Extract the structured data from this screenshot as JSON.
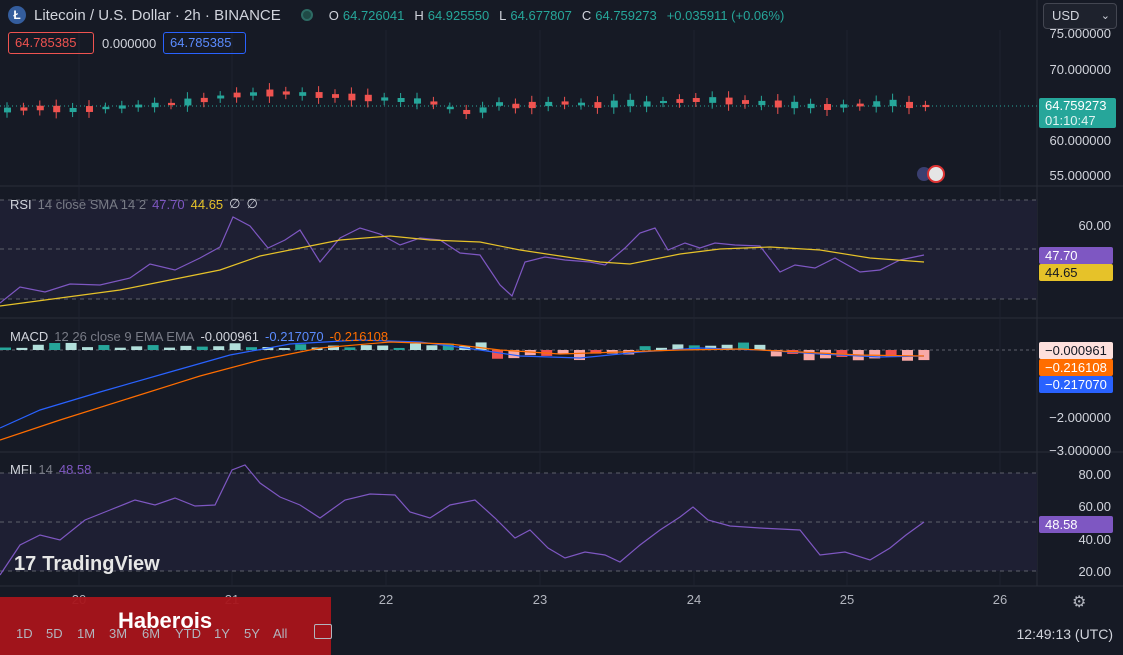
{
  "header": {
    "coin_symbol": "Ł",
    "title": "Litecoin / U.S. Dollar · 2h · BINANCE",
    "ohlc": {
      "o_label": "O",
      "o": "64.726041",
      "h_label": "H",
      "h": "64.925550",
      "l_label": "L",
      "l": "64.677807",
      "c_label": "C",
      "c": "64.759273",
      "change": "+0.035911 (+0.06%)"
    },
    "sell_price": "64.785385",
    "spread": "0.000000",
    "buy_price": "64.785385",
    "currency": "USD"
  },
  "price_axis": {
    "ticks": [
      "75.000000",
      "70.000000",
      "60.000000",
      "55.000000"
    ],
    "last_price": "64.759273",
    "countdown": "01:10:47"
  },
  "rsi": {
    "label": "RSI",
    "params": "14 close SMA 14 2",
    "value": "47.70",
    "sma": "44.65",
    "extra1": "∅",
    "extra2": "∅",
    "axis_ticks": [
      "60.00"
    ]
  },
  "macd": {
    "label": "MACD",
    "params": "12 26 close 9 EMA EMA",
    "hist": "-0.000961",
    "macd": "-0.217070",
    "signal": "-0.216108",
    "tag_hist": "−0.000961",
    "tag_signal": "−0.216108",
    "tag_macd": "−0.217070",
    "axis_ticks": [
      "−2.000000",
      "−3.000000"
    ]
  },
  "mfi": {
    "label": "MFI",
    "params": "14",
    "value": "48.58",
    "axis_ticks": [
      "80.00",
      "60.00",
      "40.00",
      "20.00"
    ]
  },
  "time_axis": {
    "labels": [
      "20",
      "21",
      "22",
      "23",
      "24",
      "25",
      "26"
    ]
  },
  "timeframes": [
    "1D",
    "5D",
    "1M",
    "3M",
    "6M",
    "YTD",
    "1Y",
    "5Y",
    "All"
  ],
  "clock": "12:49:13 (UTC)",
  "watermark": "TradingView",
  "banner": "Haberois",
  "colors": {
    "up": "#26a69a",
    "down": "#ef5350",
    "rsi_line": "#7e57c2",
    "rsi_sma": "#e6c229",
    "macd_line": "#2962ff",
    "signal_line": "#ff6d00",
    "mfi_line": "#7e57c2",
    "banner": "#a8141a"
  },
  "icons": [
    "litecoin-icon",
    "settings-gear-icon",
    "calendar-range-icon",
    "chevron-down-icon"
  ]
}
